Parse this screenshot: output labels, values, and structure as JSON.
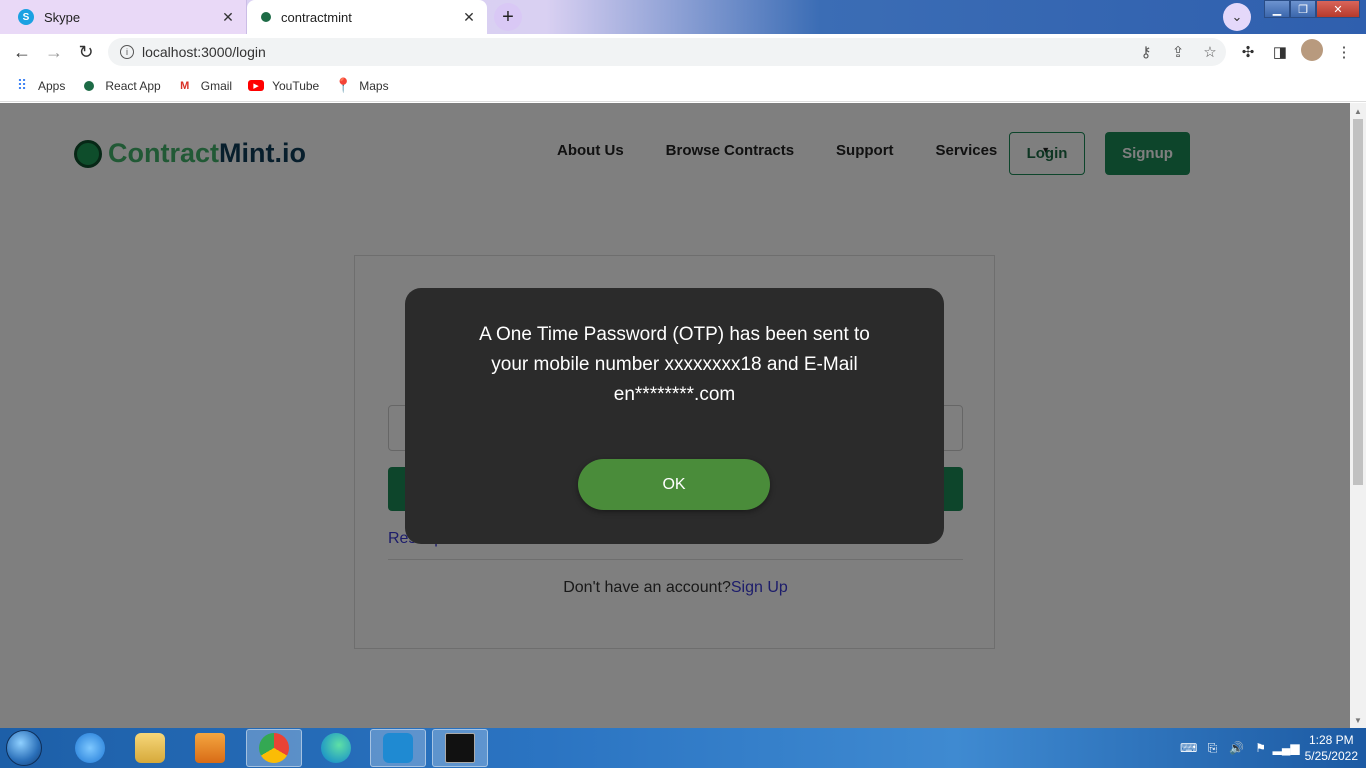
{
  "browser": {
    "tabs": [
      {
        "label": "Skype",
        "favicon": "skype-icon"
      },
      {
        "label": "contractmint",
        "favicon": "contractmint-icon"
      }
    ],
    "url": "localhost:3000/login",
    "bookmarks": [
      {
        "label": "Apps",
        "icon": "apps-grid-icon"
      },
      {
        "label": "React App",
        "icon": "react-icon"
      },
      {
        "label": "Gmail",
        "icon": "gmail-icon"
      },
      {
        "label": "YouTube",
        "icon": "youtube-icon"
      },
      {
        "label": "Maps",
        "icon": "maps-icon"
      }
    ]
  },
  "site": {
    "logo_part1": "Contract",
    "logo_part2": "Mint.io",
    "nav": [
      "About Us",
      "Browse Contracts",
      "Support",
      "Services"
    ],
    "login_label": "Login",
    "signup_label": "Signup",
    "reset_text": "Reset password",
    "no_account_text": "Don't have an account?",
    "signup_link": "Sign Up"
  },
  "modal": {
    "message_line1": "A One Time Password (OTP) has been sent to",
    "message_line2": "your mobile number xxxxxxxx18 and E-Mail",
    "message_line3": "en********.com",
    "ok_label": "OK"
  },
  "taskbar": {
    "time": "1:28 PM",
    "date": "5/25/2022"
  },
  "colors": {
    "brand_green": "#1b8a57",
    "ok_green": "#4a8c3a",
    "modal_bg": "#2b2b2b"
  }
}
